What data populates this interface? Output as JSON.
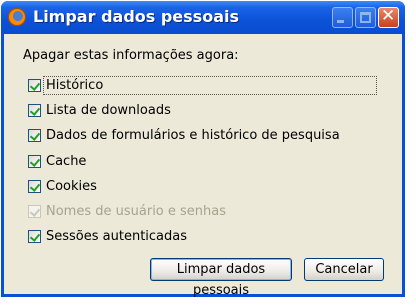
{
  "window": {
    "title": "Limpar dados pessoais",
    "controls": [
      "minimize",
      "maximize",
      "close"
    ]
  },
  "dialog": {
    "heading": "Apagar estas informações agora:",
    "options": [
      {
        "label": "Histórico",
        "checked": true,
        "enabled": true,
        "focused": true
      },
      {
        "label": "Lista de downloads",
        "checked": true,
        "enabled": true
      },
      {
        "label": "Dados de formulários e histórico de pesquisa",
        "checked": true,
        "enabled": true
      },
      {
        "label": "Cache",
        "checked": true,
        "enabled": true
      },
      {
        "label": "Cookies",
        "checked": true,
        "enabled": true
      },
      {
        "label": "Nomes de usuário e senhas",
        "checked": true,
        "enabled": false
      },
      {
        "label": "Sessões autenticadas",
        "checked": true,
        "enabled": true
      }
    ],
    "buttons": {
      "ok": "Limpar dados pessoais",
      "cancel": "Cancelar"
    }
  },
  "icons": {
    "app": "firefox-icon",
    "minimize": "minimize-icon",
    "maximize": "maximize-icon",
    "close": "close-icon",
    "check": "checkmark-icon"
  },
  "colors": {
    "titlebar": "#0b52d8",
    "client": "#ece9d8",
    "checkmark": "#21a121",
    "close_button": "#c7401f"
  }
}
